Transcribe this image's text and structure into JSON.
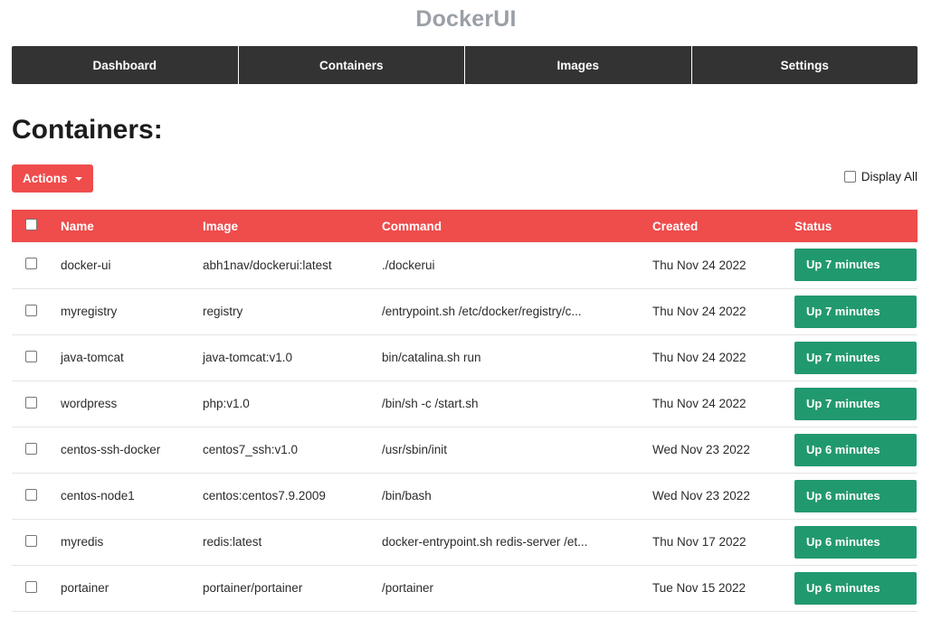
{
  "brand": {
    "title": "DockerUI"
  },
  "nav": {
    "items": [
      {
        "label": "Dashboard"
      },
      {
        "label": "Containers"
      },
      {
        "label": "Images"
      },
      {
        "label": "Settings"
      }
    ]
  },
  "page": {
    "title": "Containers:"
  },
  "toolbar": {
    "actions_label": "Actions",
    "display_all_label": "Display All",
    "display_all_checked": false
  },
  "colors": {
    "accent_red": "#ef4c4c",
    "status_green": "#21996e",
    "nav_dark": "#333333",
    "brand_gray": "#9aa0a6"
  },
  "table": {
    "columns": [
      "Name",
      "Image",
      "Command",
      "Created",
      "Status"
    ],
    "rows": [
      {
        "name": "docker-ui",
        "image": "abh1nav/dockerui:latest",
        "command": "./dockerui",
        "created": "Thu Nov 24 2022",
        "status": "Up 7 minutes"
      },
      {
        "name": "myregistry",
        "image": "registry",
        "command": "/entrypoint.sh /etc/docker/registry/c...",
        "created": "Thu Nov 24 2022",
        "status": "Up 7 minutes"
      },
      {
        "name": "java-tomcat",
        "image": "java-tomcat:v1.0",
        "command": "bin/catalina.sh run",
        "created": "Thu Nov 24 2022",
        "status": "Up 7 minutes"
      },
      {
        "name": "wordpress",
        "image": "php:v1.0",
        "command": "/bin/sh -c /start.sh",
        "created": "Thu Nov 24 2022",
        "status": "Up 7 minutes"
      },
      {
        "name": "centos-ssh-docker",
        "image": "centos7_ssh:v1.0",
        "command": "/usr/sbin/init",
        "created": "Wed Nov 23 2022",
        "status": "Up 6 minutes"
      },
      {
        "name": "centos-node1",
        "image": "centos:centos7.9.2009",
        "command": "/bin/bash",
        "created": "Wed Nov 23 2022",
        "status": "Up 6 minutes"
      },
      {
        "name": "myredis",
        "image": "redis:latest",
        "command": "docker-entrypoint.sh redis-server /et...",
        "created": "Thu Nov 17 2022",
        "status": "Up 6 minutes"
      },
      {
        "name": "portainer",
        "image": "portainer/portainer",
        "command": "/portainer",
        "created": "Tue Nov 15 2022",
        "status": "Up 6 minutes"
      }
    ]
  }
}
